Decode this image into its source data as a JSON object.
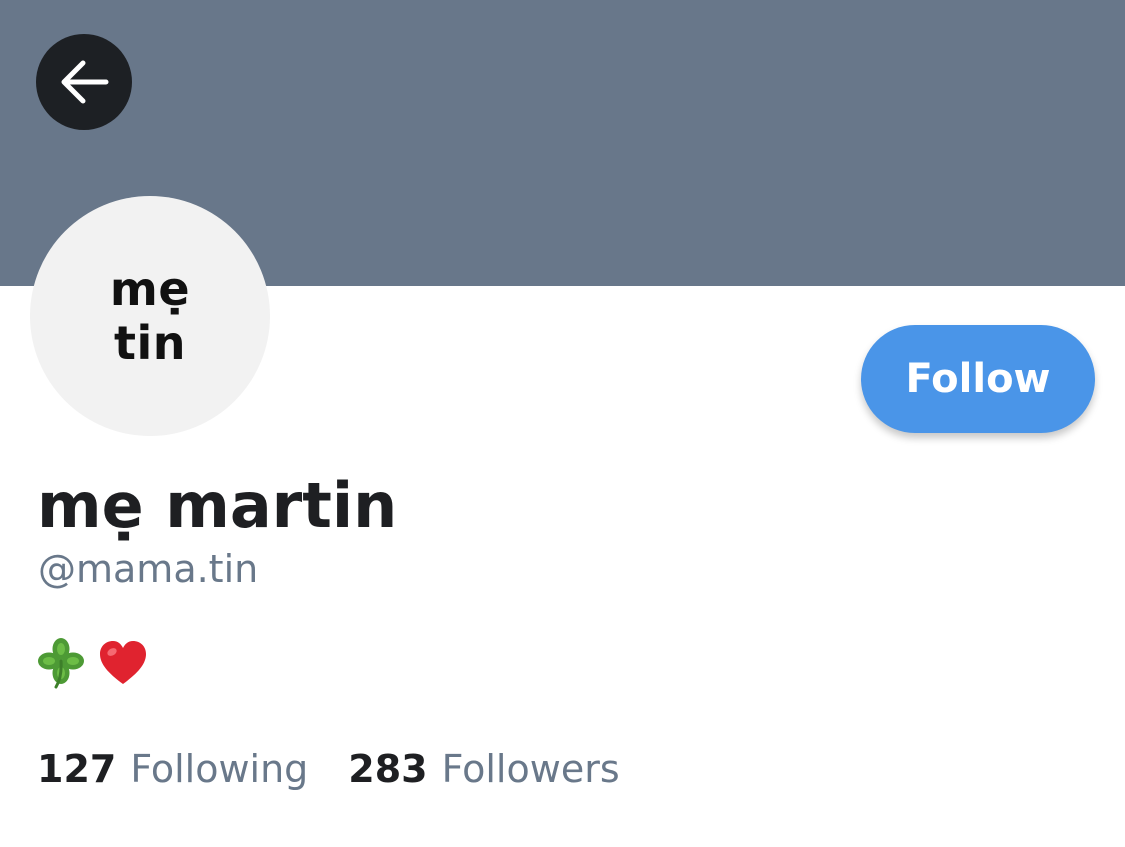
{
  "header": {
    "banner_color": "#68778a",
    "back_icon": "arrow-left-icon"
  },
  "avatar": {
    "line1": "mẹ",
    "line2": "tin",
    "background_color": "#f2f2f2"
  },
  "actions": {
    "follow_label": "Follow",
    "follow_color": "#4a95e8"
  },
  "profile": {
    "display_name": "mẹ martin",
    "handle": "@mama.tin",
    "bio_icons": [
      "four-leaf-clover-icon",
      "red-heart-icon"
    ]
  },
  "stats": {
    "following_count": "127",
    "following_label": "Following",
    "followers_count": "283",
    "followers_label": "Followers"
  }
}
